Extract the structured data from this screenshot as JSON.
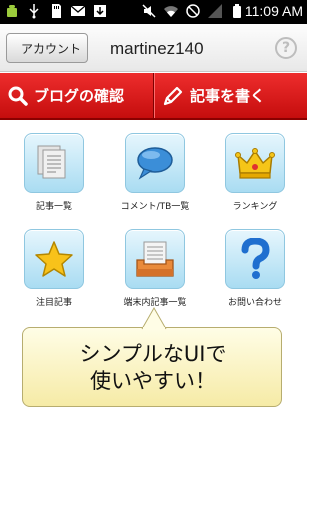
{
  "status_bar": {
    "time": "11:09 AM",
    "left_icons": [
      "android-icon",
      "usb-icon",
      "sd-card-icon",
      "gmail-icon",
      "download-icon"
    ],
    "right_icons": [
      "mute-icon",
      "wifi-icon",
      "no-sim-icon",
      "signal-icon",
      "battery-icon"
    ]
  },
  "header": {
    "back_label": "アカウント",
    "title": "martinez140",
    "help_label": "?"
  },
  "action_bar": {
    "blog_label": "ブログの確認",
    "write_label": "記事を書く"
  },
  "grid": {
    "items": [
      {
        "label": "記事一覧",
        "icon": "documents-icon"
      },
      {
        "label": "コメント/TB一覧",
        "icon": "speech-bubble-icon"
      },
      {
        "label": "ランキング",
        "icon": "crown-icon"
      },
      {
        "label": "注目記事",
        "icon": "star-icon"
      },
      {
        "label": "端末内記事一覧",
        "icon": "inbox-tray-icon"
      },
      {
        "label": "お問い合わせ",
        "icon": "question-mark-icon"
      }
    ]
  },
  "promo": {
    "line1": "シンプルなUIで",
    "line2": "使いやすい！"
  },
  "colors": {
    "action_bar": "#d91a1a",
    "tile": "#a9dcf2",
    "bubble": "#f8eeb2"
  }
}
